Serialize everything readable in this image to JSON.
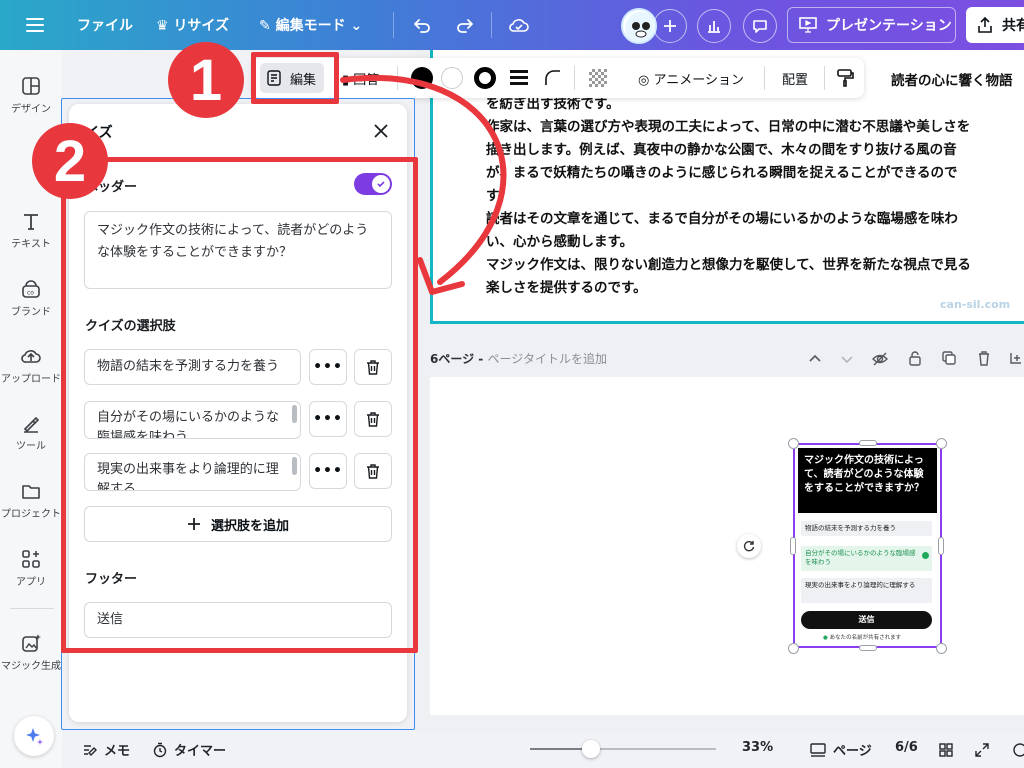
{
  "topbar": {
    "file": "ファイル",
    "resize": "リサイズ",
    "edit_mode": "編集モード",
    "presentation": "プレゼンテーション",
    "share": "共有"
  },
  "sidenav": {
    "items": [
      {
        "label": "デザイン",
        "icon": "design-icon"
      },
      {
        "label": "テキスト",
        "icon": "text-icon"
      },
      {
        "label": "ブランド",
        "icon": "brand-icon"
      },
      {
        "label": "アップロード",
        "icon": "upload-icon"
      },
      {
        "label": "ツール",
        "icon": "tool-icon"
      },
      {
        "label": "プロジェクト",
        "icon": "folder-icon"
      },
      {
        "label": "アプリ",
        "icon": "apps-icon"
      },
      {
        "label": "マジック生成",
        "icon": "magic-icon"
      }
    ]
  },
  "context_toolbar": {
    "edit": "編集",
    "answer": "回答",
    "animation": "アニメーション",
    "position": "配置"
  },
  "panel": {
    "title": "イズ",
    "header_label": "ヘッダー",
    "header_enabled": true,
    "question": "マジック作文の技術によって、読者がどのような体験をすることができますか？",
    "options_label": "クイズの選択肢",
    "options": [
      "物語の結末を予測する力を養う",
      "自分がその場にいるかのような臨場感を味わう",
      "現実の出来事をより論理的に理解する"
    ],
    "more_label": "•••",
    "add_option": "選択肢を追加",
    "footer_label": "フッター",
    "footer_value": "送信"
  },
  "page5": {
    "lines": [
      "読者の心に響く物語",
      "を紡ぎ出す技術です。",
      "作家は、言葉の選び方や表現の工夫によって、日常の中に潜む不思議や美しさを",
      "描き出します。例えば、真夜中の静かな公園で、木々の間をすり抜ける風の音",
      "が、まるで妖精たちの囁きのように感じられる瞬間を捉えることができるので",
      "す。",
      "読者はその文章を通じて、まるで自分がその場にいるかのような臨場感を味わ",
      "い、心から感動します。",
      "マジック作文は、限りない創造力と想像力を駆使して、世界を新たな視点で見る",
      "楽しさを提供するのです。"
    ],
    "watermark": "can-sil.com"
  },
  "page6": {
    "number_label": "6ページ - ",
    "title_placeholder": "ページタイトルを追加"
  },
  "preview": {
    "question": "マジック作文の技術によって、読者がどのような体験をすることができますか？",
    "options": [
      "物語の結末を予測する力を養う",
      "自分がその場にいるかのような臨場感を味わう",
      "現実の出来事をより論理的に理解する"
    ],
    "submit": "送信",
    "note": "あなたの名前が共有されます"
  },
  "bottombar": {
    "notes": "メモ",
    "timer": "タイマー",
    "zoom": "33%",
    "page": "ページ",
    "page_count": "6/6",
    "zoom_fraction": 0.33
  },
  "annotations": {
    "step1": "1",
    "step2": "2"
  },
  "colors": {
    "accent": "#7d3ce2",
    "annotation": "#e8383d",
    "selection": "#3d8ef0",
    "page_border": "#12b6c4"
  }
}
